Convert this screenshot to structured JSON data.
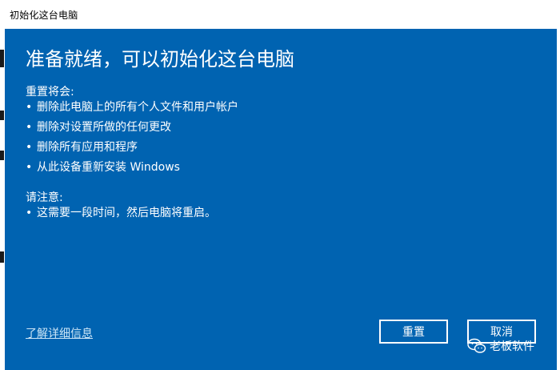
{
  "window": {
    "title": "初始化这台电脑"
  },
  "dialog": {
    "heading": "准备就绪，可以初始化这台电脑",
    "reset_section": {
      "label": "重置将会:",
      "items": [
        "删除此电脑上的所有个人文件和用户帐户",
        "删除对设置所做的任何更改",
        "删除所有应用和程序",
        "从此设备重新安装 Windows"
      ]
    },
    "notice_section": {
      "label": "请注意:",
      "items": [
        "这需要一段时间，然后电脑将重启。"
      ]
    },
    "details_link": "了解详细信息",
    "reset_button": "重置",
    "cancel_button": "取消",
    "bullet_glyph": "•"
  },
  "watermark": {
    "text": "老板软件",
    "icon": "wechat-icon"
  },
  "colors": {
    "dialog_background": "#0063b1",
    "text": "#ffffff",
    "link": "#cde6f7",
    "titlebar": "#ffffff"
  }
}
